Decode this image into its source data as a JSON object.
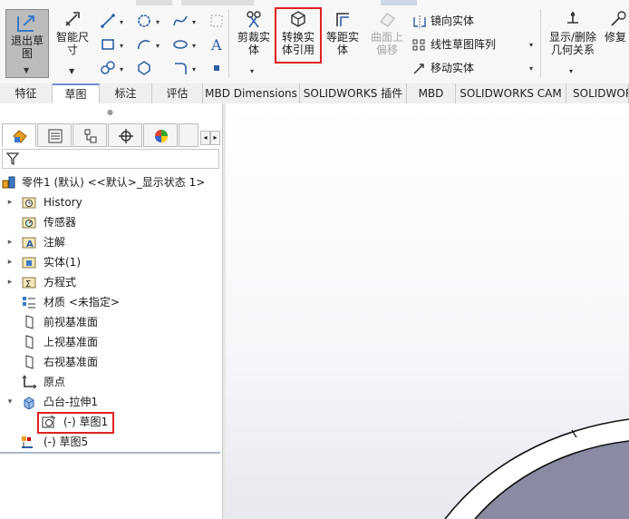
{
  "ribbon": {
    "exit_sketch": "退出草\n图",
    "smart_dimension": "智能尺\n寸",
    "trim": "剪裁实\n体",
    "convert": "转换实\n体引用",
    "offset": "等距实\n体",
    "surface_offset": "曲面上\n偏移",
    "mirror": "镜向实体",
    "linear_pattern": "线性草图阵列",
    "move": "移动实体",
    "display_delete": "显示/删除\n几何关系",
    "repair": "修复"
  },
  "tabs": [
    "特征",
    "草图",
    "标注",
    "评估",
    "MBD Dimensions",
    "SOLIDWORKS 插件",
    "MBD",
    "SOLIDWORKS CAM",
    "SOLIDWORKS"
  ],
  "active_tab": "草图",
  "tree": {
    "root": "零件1 (默认) <<默认>_显示状态 1>",
    "items": {
      "history": "History",
      "sensors": "传感器",
      "annotations": "注解",
      "solid_bodies": "实体(1)",
      "equations": "方程式",
      "material": "材质 <未指定>",
      "front_plane": "前视基准面",
      "top_plane": "上视基准面",
      "right_plane": "右视基准面",
      "origin": "原点",
      "boss_extrude": "凸台-拉伸1",
      "sketch1": "(-) 草图1",
      "sketch5": "(-) 草图5"
    }
  },
  "colors": {
    "highlight": "#e02020",
    "part_fill": "#8a8ba3"
  }
}
